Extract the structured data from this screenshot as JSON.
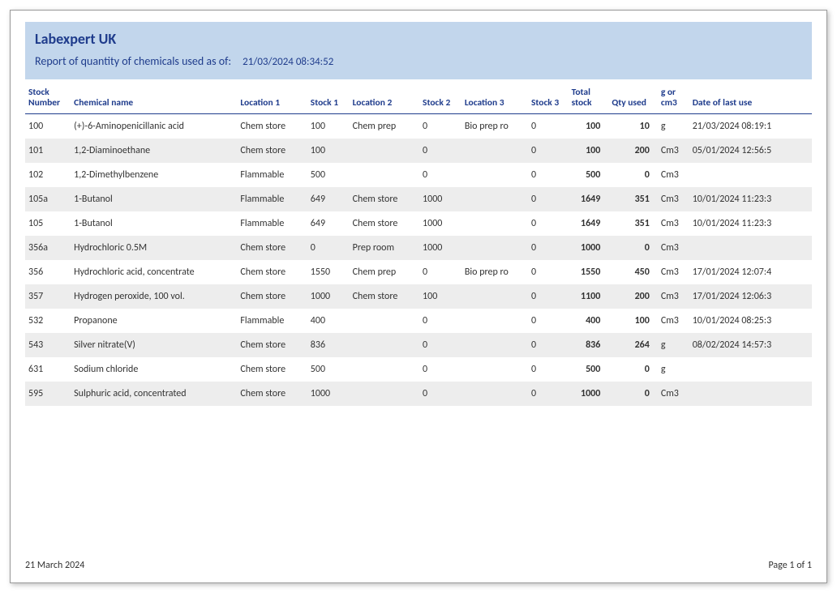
{
  "header": {
    "title": "Labexpert UK",
    "subtitle": "Report of quantity of chemicals used as of:",
    "as_of": "21/03/2024 08:34:52"
  },
  "columns": {
    "stock_number": "Stock Number",
    "chemical_name": "Chemical name",
    "location1": "Location 1",
    "stock1": "Stock 1",
    "location2": "Location 2",
    "stock2": "Stock 2",
    "location3": "Location 3",
    "stock3": "Stock 3",
    "total_stock": "Total stock",
    "qty_used": "Qty used",
    "unit": "g or cm3",
    "last_use": "Date of last use"
  },
  "rows": [
    {
      "stock_number": "100",
      "chemical_name": "(+)-6-Aminopenicillanic acid",
      "location1": "Chem store",
      "stock1": "100",
      "location2": "Chem prep",
      "stock2": "0",
      "location3": "Bio prep ro",
      "stock3": "0",
      "total": "100",
      "qty": "10",
      "unit": "g",
      "last_use": "21/03/2024 08:19:1"
    },
    {
      "stock_number": "101",
      "chemical_name": "1,2-Diaminoethane",
      "location1": "Chem store",
      "stock1": "100",
      "location2": "",
      "stock2": "0",
      "location3": "",
      "stock3": "0",
      "total": "100",
      "qty": "200",
      "unit": "Cm3",
      "last_use": "05/01/2024 12:56:5"
    },
    {
      "stock_number": "102",
      "chemical_name": "1,2-Dimethylbenzene",
      "location1": "Flammable",
      "stock1": "500",
      "location2": "",
      "stock2": "0",
      "location3": "",
      "stock3": "0",
      "total": "500",
      "qty": "0",
      "unit": "Cm3",
      "last_use": ""
    },
    {
      "stock_number": "105a",
      "chemical_name": "1-Butanol",
      "location1": "Flammable",
      "stock1": "649",
      "location2": "Chem store",
      "stock2": "1000",
      "location3": "",
      "stock3": "0",
      "total": "1649",
      "qty": "351",
      "unit": "Cm3",
      "last_use": "10/01/2024 11:23:3"
    },
    {
      "stock_number": "105",
      "chemical_name": "1-Butanol",
      "location1": "Flammable",
      "stock1": "649",
      "location2": "Chem store",
      "stock2": "1000",
      "location3": "",
      "stock3": "0",
      "total": "1649",
      "qty": "351",
      "unit": "Cm3",
      "last_use": "10/01/2024 11:23:3"
    },
    {
      "stock_number": "356a",
      "chemical_name": "Hydrochloric 0.5M",
      "location1": "Chem store",
      "stock1": "0",
      "location2": "Prep room",
      "stock2": "1000",
      "location3": "",
      "stock3": "0",
      "total": "1000",
      "qty": "0",
      "unit": "Cm3",
      "last_use": ""
    },
    {
      "stock_number": "356",
      "chemical_name": "Hydrochloric acid, concentrate",
      "location1": "Chem store",
      "stock1": "1550",
      "location2": "Chem prep",
      "stock2": "0",
      "location3": "Bio prep ro",
      "stock3": "0",
      "total": "1550",
      "qty": "450",
      "unit": "Cm3",
      "last_use": "17/01/2024 12:07:4"
    },
    {
      "stock_number": "357",
      "chemical_name": "Hydrogen peroxide, 100 vol.",
      "location1": "Chem store",
      "stock1": "1000",
      "location2": "Chem store",
      "stock2": "100",
      "location3": "",
      "stock3": "0",
      "total": "1100",
      "qty": "200",
      "unit": "Cm3",
      "last_use": "17/01/2024 12:06:3"
    },
    {
      "stock_number": "532",
      "chemical_name": "Propanone",
      "location1": "Flammable",
      "stock1": "400",
      "location2": "",
      "stock2": "0",
      "location3": "",
      "stock3": "0",
      "total": "400",
      "qty": "100",
      "unit": "Cm3",
      "last_use": "10/01/2024 08:25:3"
    },
    {
      "stock_number": "543",
      "chemical_name": "Silver nitrate(V)",
      "location1": "Chem store",
      "stock1": "836",
      "location2": "",
      "stock2": "0",
      "location3": "",
      "stock3": "0",
      "total": "836",
      "qty": "264",
      "unit": "g",
      "last_use": "08/02/2024 14:57:3"
    },
    {
      "stock_number": "631",
      "chemical_name": "Sodium chloride",
      "location1": "Chem store",
      "stock1": "500",
      "location2": "",
      "stock2": "0",
      "location3": "",
      "stock3": "0",
      "total": "500",
      "qty": "0",
      "unit": "g",
      "last_use": ""
    },
    {
      "stock_number": "595",
      "chemical_name": "Sulphuric acid, concentrated",
      "location1": "Chem store",
      "stock1": "1000",
      "location2": "",
      "stock2": "0",
      "location3": "",
      "stock3": "0",
      "total": "1000",
      "qty": "0",
      "unit": "Cm3",
      "last_use": ""
    }
  ],
  "footer": {
    "date": "21 March 2024",
    "page": "Page 1 of 1"
  }
}
